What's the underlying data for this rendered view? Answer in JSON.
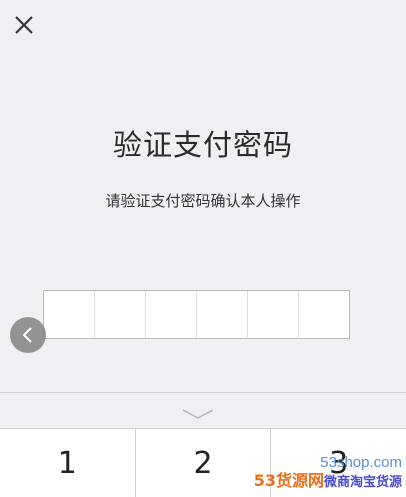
{
  "header": {
    "close_icon": "close-icon"
  },
  "main": {
    "title": "验证支付密码",
    "subtitle": "请验证支付密码确认本人操作",
    "pin_length": 6,
    "pin_filled": 0
  },
  "side": {
    "back_icon": "chevron-left-icon"
  },
  "keyboard": {
    "collapse_icon": "chevron-down-icon",
    "keys": [
      "1",
      "2",
      "3"
    ]
  },
  "watermark": {
    "site": "53shop.com",
    "brand": "53货源网",
    "tag": "微商淘宝货源"
  },
  "colors": {
    "background": "#efeff4",
    "keyboard_bg": "#ffffff",
    "watermark_blue": "#5a8fd6",
    "watermark_orange": "#e8701a"
  }
}
